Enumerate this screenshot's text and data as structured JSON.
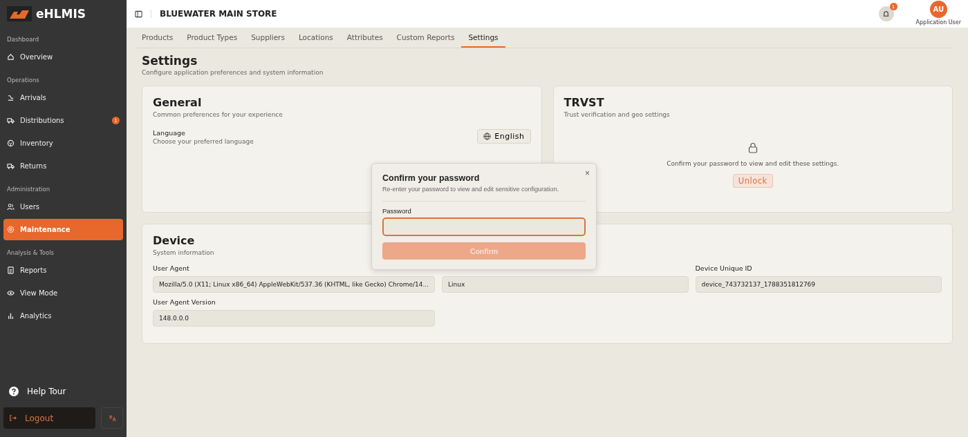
{
  "sidebar": {
    "brand": "eHLMIS",
    "sections": [
      {
        "title": "Dashboard",
        "items": [
          {
            "label": "Overview",
            "selected": false
          }
        ]
      },
      {
        "title": "Operations",
        "items": [
          {
            "label": "Arrivals",
            "selected": false
          },
          {
            "label": "Distributions",
            "selected": false,
            "badge": "1"
          },
          {
            "label": "Inventory",
            "selected": false
          },
          {
            "label": "Returns",
            "selected": false
          }
        ]
      },
      {
        "title": "Administration",
        "items": [
          {
            "label": "Users",
            "selected": false
          },
          {
            "label": "Maintenance",
            "selected": true
          }
        ]
      },
      {
        "title": "Analysis & Tools",
        "items": [
          {
            "label": "Reports",
            "selected": false
          },
          {
            "label": "View Mode",
            "selected": false
          },
          {
            "label": "Analytics",
            "selected": false
          }
        ]
      }
    ],
    "help": "Help Tour",
    "logout": "Logout"
  },
  "header": {
    "store": "BLUEWATER MAIN STORE",
    "notifications": "1",
    "avatar": "AU",
    "user": "Application User"
  },
  "tabs": [
    {
      "label": "Products",
      "selected": false
    },
    {
      "label": "Product Types",
      "selected": false
    },
    {
      "label": "Suppliers",
      "selected": false
    },
    {
      "label": "Locations",
      "selected": false
    },
    {
      "label": "Attributes",
      "selected": false
    },
    {
      "label": "Custom Reports",
      "selected": false
    },
    {
      "label": "Settings",
      "selected": true
    }
  ],
  "page": {
    "title": "Settings",
    "subtitle": "Configure application preferences and system information"
  },
  "general": {
    "title": "General",
    "subtitle": "Common preferences for your experience",
    "setting_label": "Language",
    "setting_hint": "Choose your preferred language",
    "language": "English"
  },
  "trvst": {
    "title": "TRVST",
    "subtitle": "Trust verification and geo settings",
    "message": "Confirm your password to view and edit these settings.",
    "button": "Unlock"
  },
  "device": {
    "title": "Device",
    "subtitle": "System information",
    "fields": [
      {
        "label": "User Agent",
        "value": "Mozilla/5.0 (X11; Linux x86_64) AppleWebKit/537.36 (KHTML, like Gecko) Chrome/14..."
      },
      {
        "value": "Linux"
      },
      {
        "label": "Device Unique ID",
        "value": "device_743732137_1788351812769"
      },
      {
        "label": "User Agent Version",
        "value": "148.0.0.0"
      }
    ]
  },
  "dialog": {
    "title": "Confirm your password",
    "subtitle": "Re-enter your password to view and edit sensitive configuration.",
    "close": "×",
    "field_label": "Password",
    "button": "Confirm",
    "button_disabled": true
  }
}
